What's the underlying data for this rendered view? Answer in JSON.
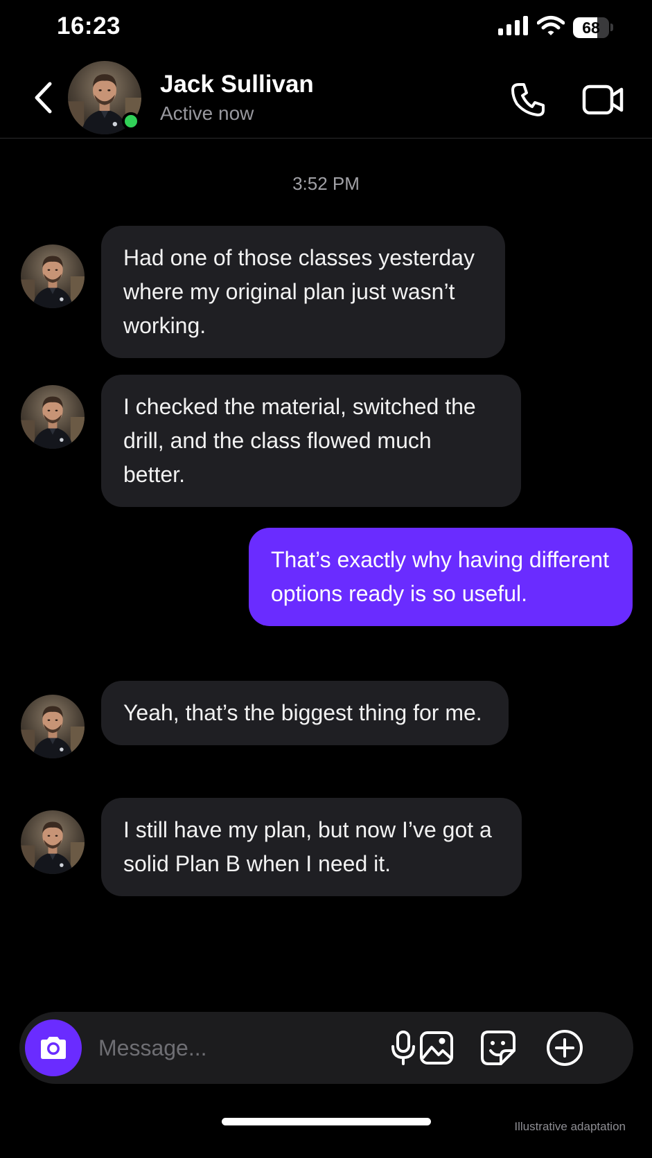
{
  "status_bar": {
    "time": "16:23",
    "battery": "68",
    "battery_level": 0.68
  },
  "header": {
    "contact_name": "Jack Sullivan",
    "contact_status": "Active now",
    "presence_color": "#31d158"
  },
  "conversation": {
    "timestamp": "3:52 PM",
    "messages": [
      {
        "direction": "incoming",
        "text": "Had one of those classes yesterday where my original plan just wasn’t working."
      },
      {
        "direction": "incoming",
        "text": "I checked the material, switched the drill, and the class flowed much better."
      },
      {
        "direction": "outgoing",
        "text": "That’s exactly why having different options ready is so useful."
      },
      {
        "direction": "incoming",
        "text": "Yeah, that’s the biggest thing for me."
      },
      {
        "direction": "incoming",
        "text": "I still have my plan, but now I’ve got a solid Plan B when I need it."
      }
    ]
  },
  "composer": {
    "placeholder": "Message...",
    "icons": [
      "camera-icon",
      "microphone-icon",
      "image-icon",
      "sticker-icon",
      "plus-circle-icon"
    ]
  },
  "colors": {
    "accent": "#6a2cff",
    "incoming_bubble": "#1f1f23",
    "background": "#000000"
  },
  "footer": {
    "watermark": "Illustrative adaptation"
  }
}
